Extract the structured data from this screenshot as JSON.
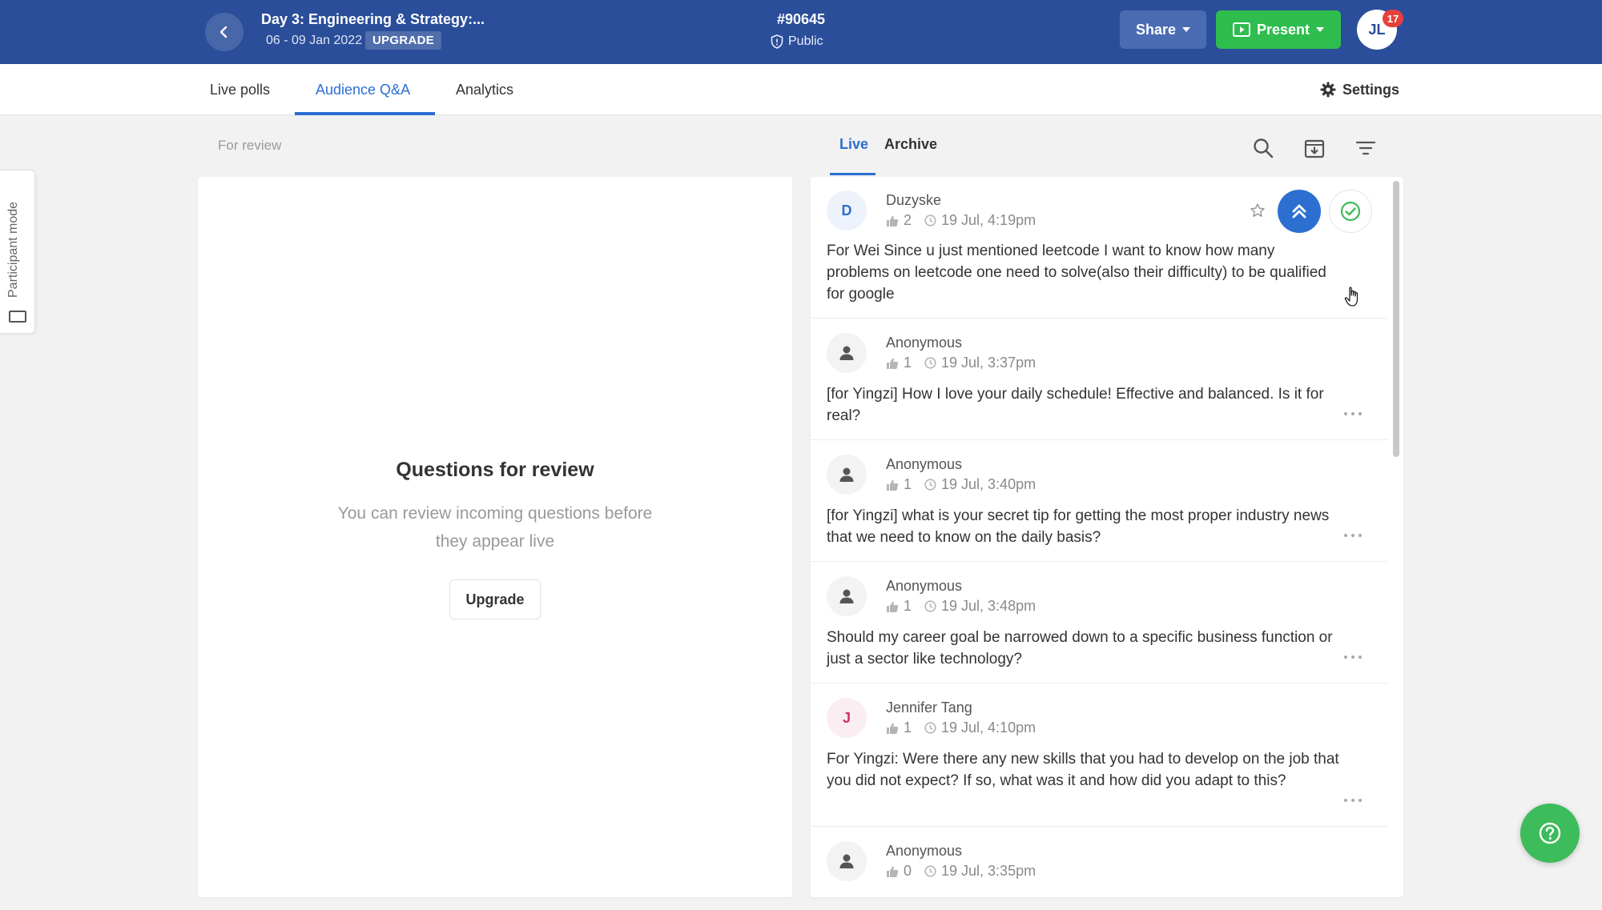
{
  "header": {
    "event_title": "Day 3: Engineering & Strategy:...",
    "event_dates": "06 - 09 Jan 2022",
    "upgrade_badge": "UPGRADE",
    "event_code": "#90645",
    "visibility": "Public",
    "share_label": "Share",
    "present_label": "Present",
    "avatar_initials": "JL",
    "notification_count": "17",
    "colors": {
      "bar": "#2a4e9a",
      "present": "#2fbd4f"
    }
  },
  "nav": {
    "tabs": [
      {
        "label": "Live polls",
        "active": false
      },
      {
        "label": "Audience Q&A",
        "active": true
      },
      {
        "label": "Analytics",
        "active": false
      }
    ],
    "settings_label": "Settings"
  },
  "side_tab": {
    "label": "Participant mode"
  },
  "review": {
    "section_label": "For review",
    "title": "Questions for review",
    "description": "You can review incoming questions before they appear live",
    "upgrade_label": "Upgrade"
  },
  "qa": {
    "tabs": [
      {
        "label": "Live",
        "active": true
      },
      {
        "label": "Archive",
        "active": false
      }
    ],
    "toolbar_icons": [
      "search-icon",
      "archive-download-icon",
      "filter-icon"
    ],
    "questions": [
      {
        "avatar": "D",
        "author": "Duzyske",
        "likes": "2",
        "time": "19 Jul, 4:19pm",
        "text": "For Wei Since u just mentioned leetcode I want to know how many problems on leetcode one need to solve(also their difficulty) to be qualified for google"
      },
      {
        "avatar": "",
        "author": "Anonymous",
        "likes": "1",
        "time": "19 Jul, 3:37pm",
        "text": "[for Yingzi] How I love your daily schedule! Effective and balanced. Is it for real?"
      },
      {
        "avatar": "",
        "author": "Anonymous",
        "likes": "1",
        "time": "19 Jul, 3:40pm",
        "text": "[for Yingzi] what is your secret tip for getting the most proper industry news that we need to know on the daily basis?"
      },
      {
        "avatar": "",
        "author": "Anonymous",
        "likes": "1",
        "time": "19 Jul, 3:48pm",
        "text": "Should my career goal be narrowed down to a specific business function or just a sector like technology?"
      },
      {
        "avatar": "J",
        "author": "Jennifer Tang",
        "likes": "1",
        "time": "19 Jul, 4:10pm",
        "text": "For Yingzi: Were there any new skills that you had to develop on the job that you did not expect? If so, what was it and how did you adapt to this?"
      },
      {
        "avatar": "",
        "author": "Anonymous",
        "likes": "0",
        "time": "19 Jul, 3:35pm",
        "text": ""
      }
    ]
  }
}
